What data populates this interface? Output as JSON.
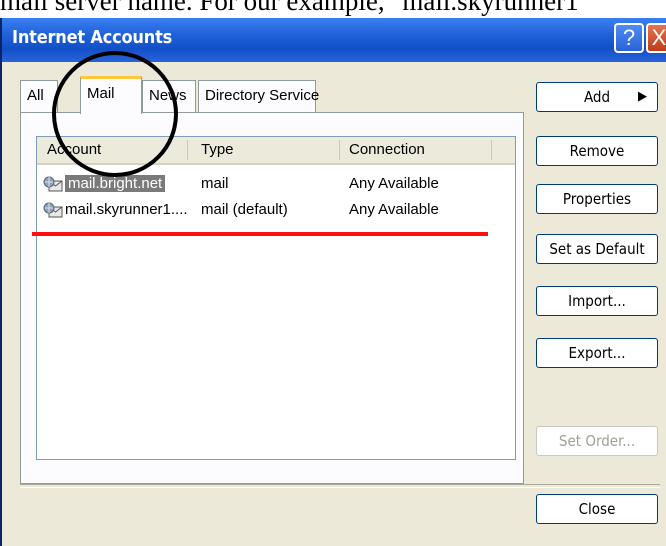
{
  "caption": "mail server name. For our example, \"mail.skyrunner1",
  "window": {
    "title": "Internet Accounts",
    "help_glyph": "?",
    "close_glyph": "X"
  },
  "tabs": [
    {
      "label": "All"
    },
    {
      "label": "Mail"
    },
    {
      "label": "News"
    },
    {
      "label": "Directory Service"
    }
  ],
  "active_tab": "Mail",
  "list": {
    "columns": [
      "Account",
      "Type",
      "Connection"
    ],
    "rows": [
      {
        "account": "mail.bright.net",
        "type": "mail",
        "connection": "Any Available",
        "selected": true
      },
      {
        "account": "mail.skyrunner1....",
        "type": "mail (default)",
        "connection": "Any Available",
        "selected": false
      }
    ]
  },
  "buttons": {
    "add": "Add",
    "add_arrow": "▶",
    "remove": "Remove",
    "properties": "Properties",
    "set_default": "Set as Default",
    "import": "Import...",
    "export": "Export...",
    "set_order": "Set Order...",
    "close": "Close"
  },
  "colors": {
    "titlebar": "#1f5fd7",
    "annotation_line": "#ff1010",
    "annotation_circle": "#000000",
    "selection": "#7a7a7a"
  }
}
